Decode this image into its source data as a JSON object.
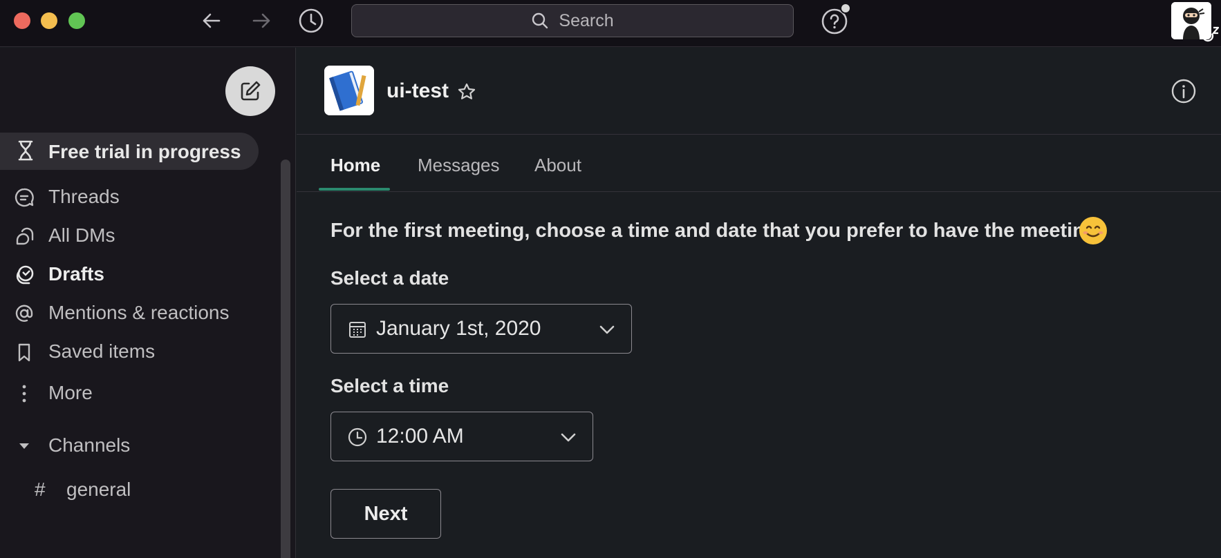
{
  "titlebar": {
    "search_placeholder": "Search"
  },
  "sidebar": {
    "trial_label": "Free trial in progress",
    "items": [
      {
        "label": "Threads",
        "icon": "threads-icon"
      },
      {
        "label": "All DMs",
        "icon": "dms-icon"
      },
      {
        "label": "Drafts",
        "icon": "drafts-icon"
      },
      {
        "label": "Mentions & reactions",
        "icon": "at-icon"
      },
      {
        "label": "Saved items",
        "icon": "bookmark-icon"
      },
      {
        "label": "More",
        "icon": "more-vertical-icon"
      }
    ],
    "channels_label": "Channels",
    "channels": [
      {
        "prefix": "#",
        "name": "general"
      }
    ]
  },
  "header": {
    "app_name": "ui-test"
  },
  "tabs": [
    {
      "label": "Home"
    },
    {
      "label": "Messages"
    },
    {
      "label": "About"
    }
  ],
  "content": {
    "prompt": "For the first meeting, choose a time and date that you prefer to have the meeting",
    "date_label": "Select a date",
    "date_value": "January 1st, 2020",
    "time_label": "Select a time",
    "time_value": "12:00 AM",
    "next_label": "Next"
  },
  "colors": {
    "background": "#1a1d21",
    "sidebar": "#19171d",
    "titlebar": "#121016",
    "accent_tab": "#2b8a6e"
  }
}
